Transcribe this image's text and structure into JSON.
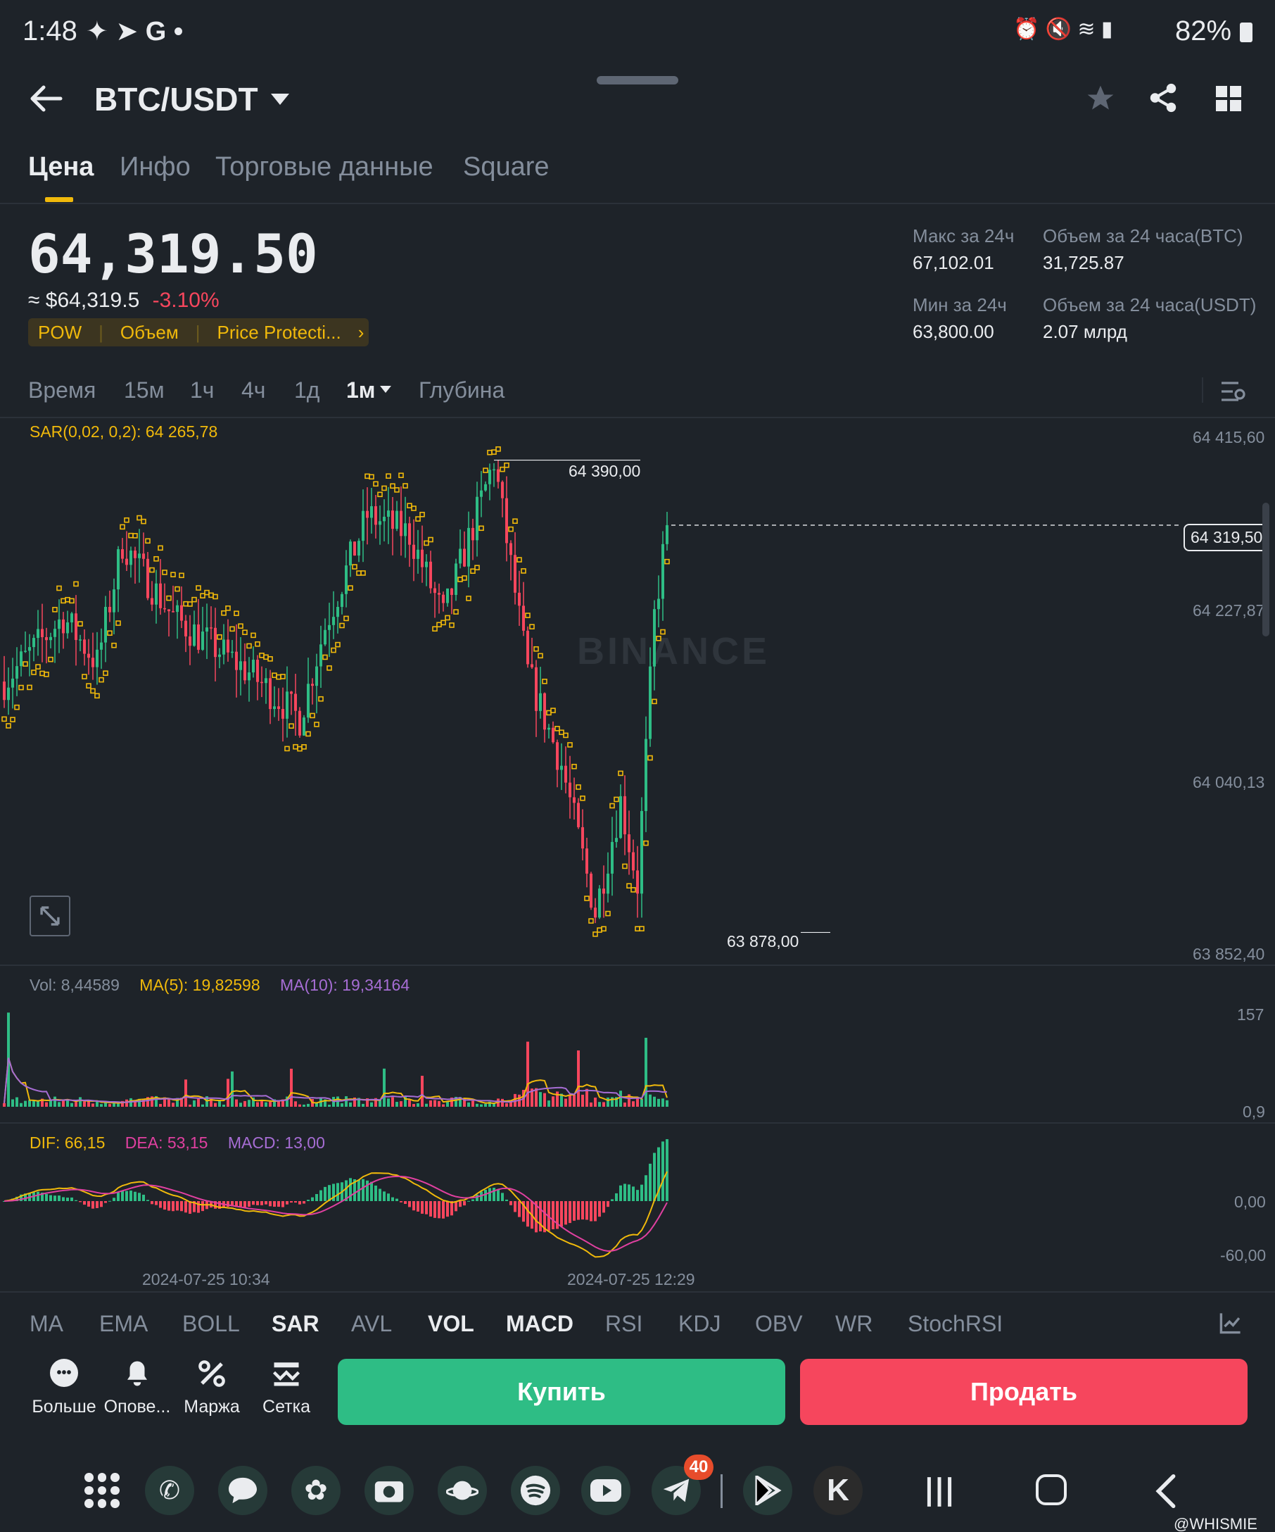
{
  "status_bar": {
    "time": "1:48",
    "battery": "82%"
  },
  "header": {
    "pair": "BTC/USDT"
  },
  "tabs": [
    "Цена",
    "Инфо",
    "Торговые данные",
    "Square"
  ],
  "price": {
    "last": "64,319.50",
    "approx": "≈ $64,319.5",
    "change": "-3.10%",
    "tags": [
      "POW",
      "Объем",
      "Price Protecti..."
    ]
  },
  "stats": {
    "high_label": "Макс за 24ч",
    "high": "67,102.01",
    "low_label": "Мин за 24ч",
    "low": "63,800.00",
    "vol_btc_label": "Объем за 24 часа(BTC)",
    "vol_btc": "31,725.87",
    "vol_usdt_label": "Объем за 24 часа(USDT)",
    "vol_usdt": "2.07 млрд"
  },
  "intervals": [
    "Время",
    "15м",
    "1ч",
    "4ч",
    "1д",
    "1м",
    "Глубина"
  ],
  "active_interval": "1м",
  "chart": {
    "sar_label": "SAR(0,02, 0,2): 64 265,78",
    "y_ticks": [
      "64 415,60",
      "64 227,87",
      "64 040,13",
      "63 852,40"
    ],
    "current_price_label": "64 319,50",
    "high_marker": "64 390,00",
    "low_marker": "63 878,00",
    "watermark": "BINANCE",
    "vol": {
      "vol": "Vol: 8,44589",
      "ma5": "MA(5): 19,82598",
      "ma10": "MA(10): 19,34164",
      "y_top": "157",
      "y_bottom": "0,9"
    },
    "macd": {
      "dif": "DIF: 66,15",
      "dea": "DEA: 53,15",
      "macd": "MACD: 13,00",
      "y_top": "0,00",
      "y_bottom": "-60,00"
    },
    "x_labels": [
      "2024-07-25 10:34",
      "2024-07-25 12:29"
    ]
  },
  "chart_data": {
    "type": "candlestick",
    "price_axis": [
      63852.4,
      64415.6
    ],
    "last_price": 64319.5,
    "high": 64390.0,
    "low": 63878.0,
    "sar": 64265.78,
    "volume_axis": [
      0.9,
      157
    ],
    "macd_axis": [
      -60,
      0
    ],
    "macd": {
      "dif": 66.15,
      "dea": 53.15,
      "macd": 13.0
    },
    "x_labels": [
      "2024-07-25 10:34",
      "2024-07-25 12:29"
    ]
  },
  "indicators": [
    "MA",
    "EMA",
    "BOLL",
    "SAR",
    "AVL",
    "VOL",
    "MACD",
    "RSI",
    "KDJ",
    "OBV",
    "WR",
    "StochRSI"
  ],
  "indicators_on": [
    "SAR",
    "VOL",
    "MACD"
  ],
  "toolbar": [
    "Больше",
    "Опове...",
    "Маржа",
    "Сетка"
  ],
  "buy_label": "Купить",
  "sell_label": "Продать",
  "nav": {
    "badge": "40",
    "watermark": "@WHISMIE"
  },
  "colors": {
    "up": "#2ebd85",
    "down": "#f6465d",
    "accent": "#f0b90b",
    "bg": "#1e2329"
  }
}
